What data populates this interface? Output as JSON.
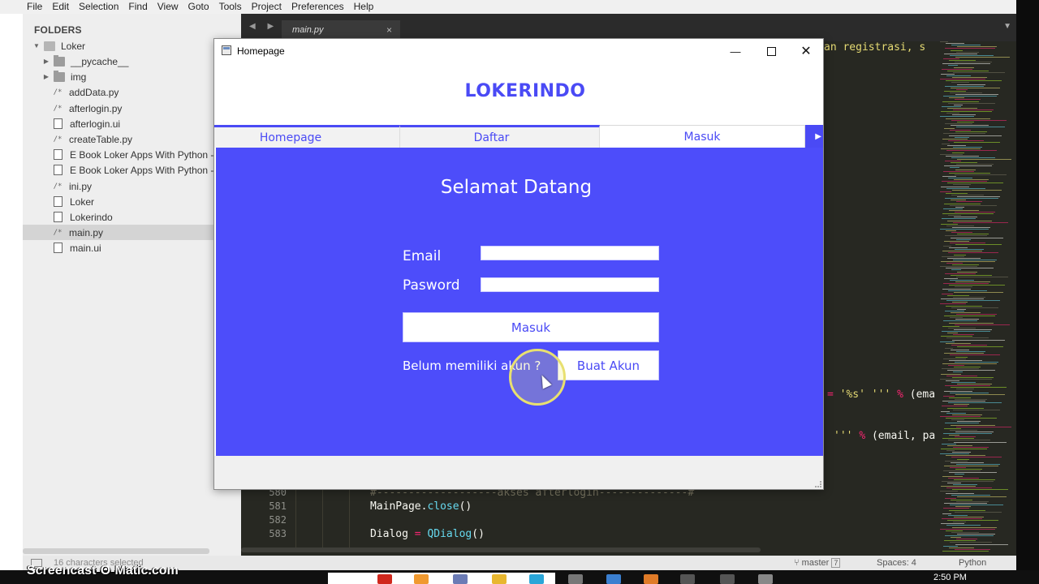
{
  "editor": {
    "menu": [
      "File",
      "Edit",
      "Selection",
      "Find",
      "View",
      "Goto",
      "Tools",
      "Project",
      "Preferences",
      "Help"
    ],
    "sidebar": {
      "title": "FOLDERS",
      "root": "Loker",
      "items": [
        {
          "label": "__pycache__",
          "kind": "folder"
        },
        {
          "label": "img",
          "kind": "folder"
        },
        {
          "label": "addData.py",
          "kind": "py"
        },
        {
          "label": "afterlogin.py",
          "kind": "py"
        },
        {
          "label": "afterlogin.ui",
          "kind": "file"
        },
        {
          "label": "createTable.py",
          "kind": "py"
        },
        {
          "label": "E Book Loker Apps With Python - K",
          "kind": "file"
        },
        {
          "label": "E Book Loker Apps With Python - K",
          "kind": "file"
        },
        {
          "label": "ini.py",
          "kind": "py"
        },
        {
          "label": "Loker",
          "kind": "file"
        },
        {
          "label": "Lokerindo",
          "kind": "file"
        },
        {
          "label": "main.py",
          "kind": "py",
          "selected": true
        },
        {
          "label": "main.ui",
          "kind": "file"
        }
      ]
    },
    "tab": {
      "label": "main.py",
      "close": "×"
    },
    "code_top_fragment": "an registrasi, s",
    "code_fragments": [
      {
        "text": "= '%s' ''' % (ema"
      },
      {
        "text": "''' % (email, pa"
      }
    ],
    "lines": [
      {
        "num": "580",
        "text": "#-------------------akses afterlogin--------------#",
        "cls": "comment"
      },
      {
        "num": "581",
        "text": "MainPage.close()",
        "cls": ""
      },
      {
        "num": "582",
        "text": "",
        "cls": ""
      },
      {
        "num": "583",
        "text": "Dialog = QDialog()",
        "cls": ""
      }
    ],
    "status": {
      "chars": "16 characters selected",
      "branch": "master",
      "branch_badge": "7",
      "spaces": "Spaces: 4",
      "language": "Python"
    }
  },
  "watermark": "Screencast-O-Matic.com",
  "taskbar": {
    "time": "2:50 PM"
  },
  "dialog": {
    "window_title": "Homepage",
    "brand": "LOKERINDO",
    "tabs": [
      {
        "label": "Homepage"
      },
      {
        "label": "Daftar"
      },
      {
        "label": "Masuk",
        "active": true
      }
    ],
    "welcome": "Selamat Datang",
    "email_label": "Email",
    "password_label": "Pasword",
    "email_value": "",
    "password_value": "",
    "login_button": "Masuk",
    "no_account_text": "Belum memiliki akun ?",
    "register_button": "Buat Akun"
  },
  "colors": {
    "accent": "#4a4af5",
    "panel": "#4d4dfa",
    "editor_bg": "#272822"
  }
}
